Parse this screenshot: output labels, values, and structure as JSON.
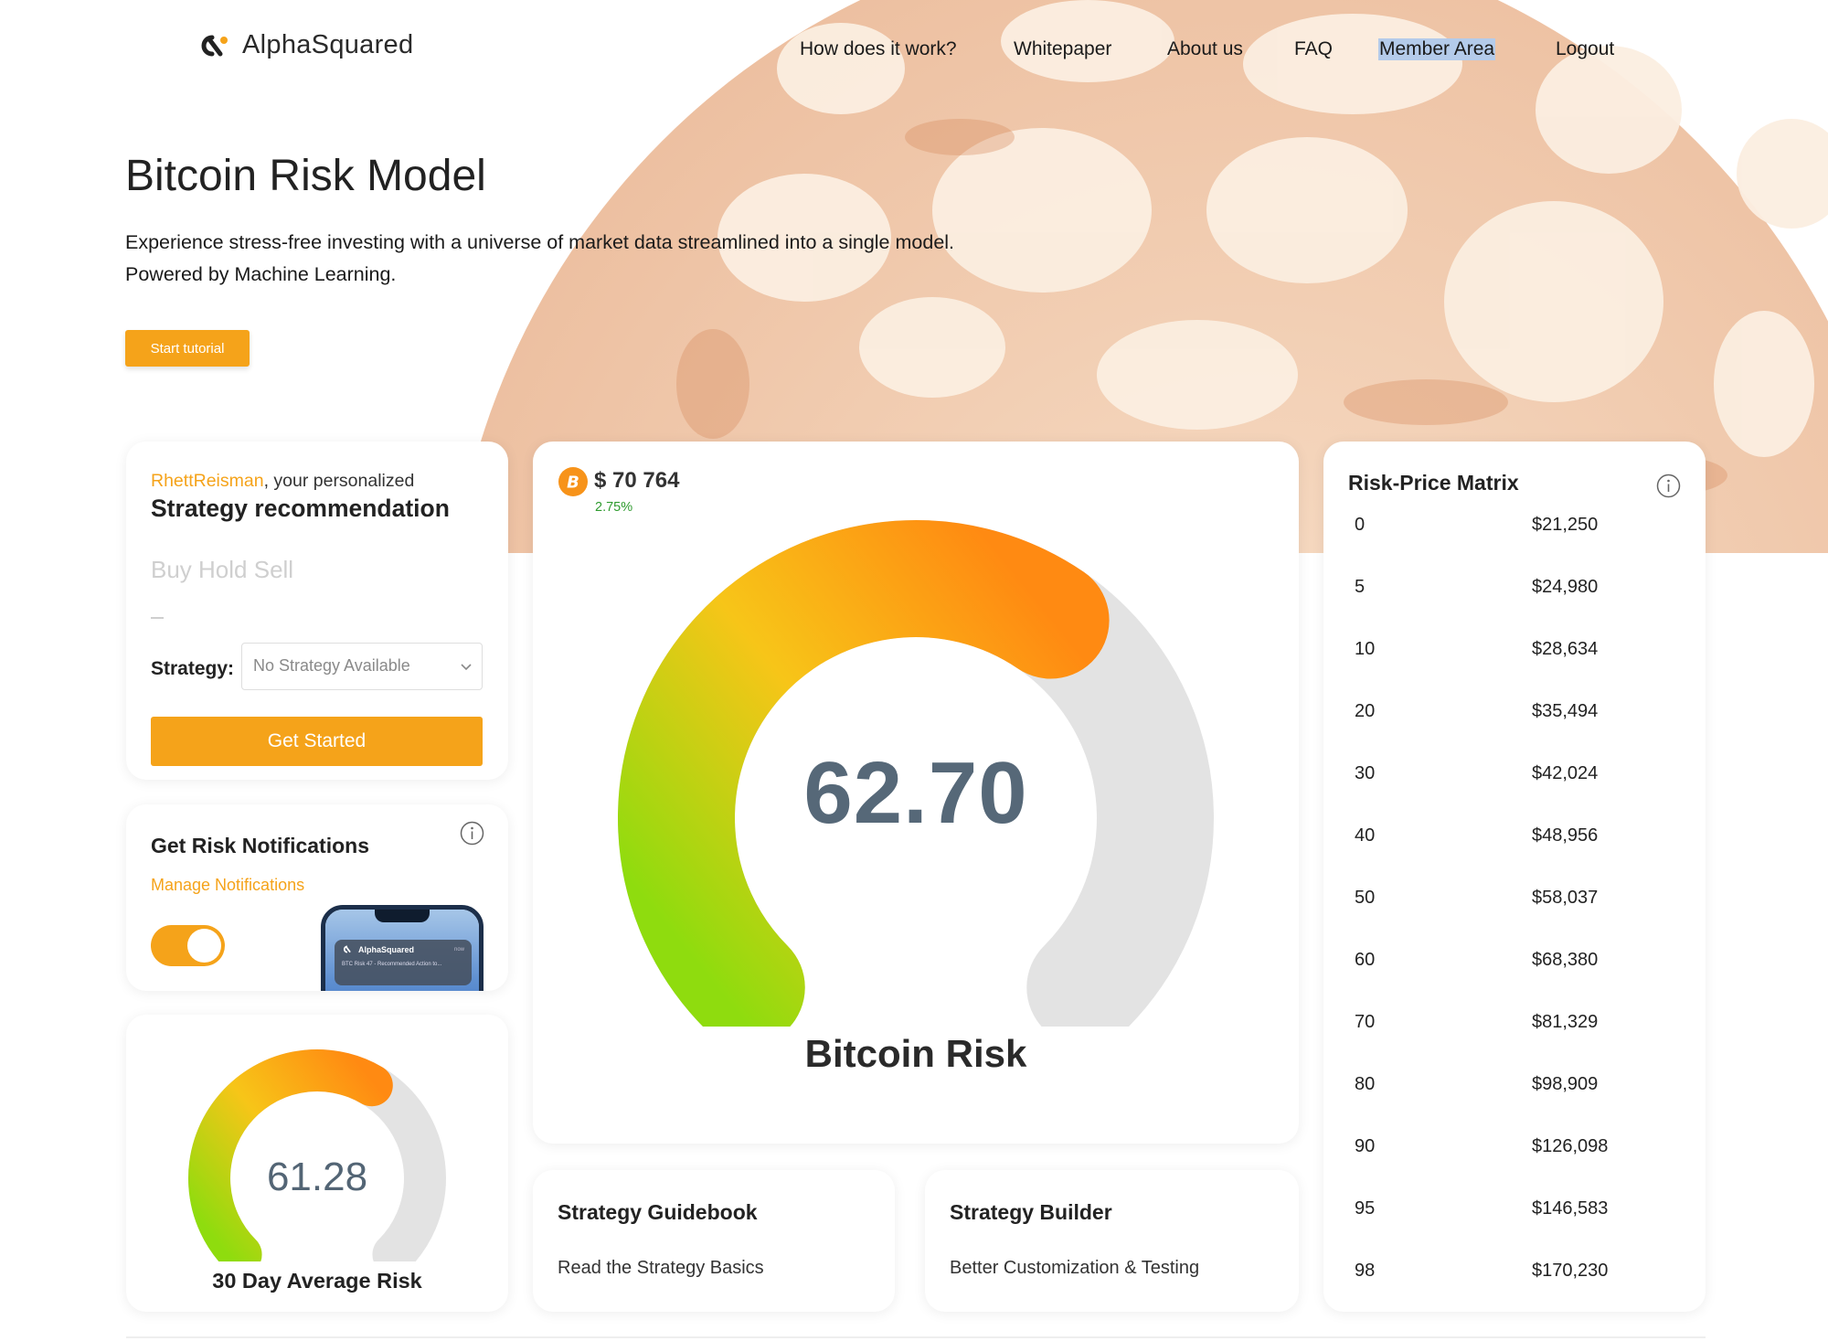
{
  "brand": {
    "name": "AlphaSquared",
    "accent": "#f5a31a"
  },
  "nav": {
    "items": [
      {
        "label": "How does it work?"
      },
      {
        "label": "Whitepaper"
      },
      {
        "label": "About us"
      },
      {
        "label": "FAQ"
      },
      {
        "label": "Member Area",
        "active": true
      },
      {
        "label": "Logout"
      }
    ]
  },
  "hero": {
    "title": "Bitcoin Risk Model",
    "subtitle_line1": "Experience stress-free investing with a universe of market data streamlined into a single model.",
    "subtitle_line2": "Powered by Machine Learning.",
    "tutorial_button": "Start tutorial"
  },
  "strategy_card": {
    "username": "RhettReisman",
    "intro_suffix": ", your personalized",
    "heading": "Strategy recommendation",
    "actions_placeholder": "Buy Hold Sell",
    "strategy_label": "Strategy:",
    "strategy_select_value": "No Strategy Available",
    "cta_button": "Get Started"
  },
  "notifications_card": {
    "title": "Get Risk Notifications",
    "link": "Manage Notifications",
    "toggle_on": true,
    "phone_preview": {
      "app_name": "AlphaSquared",
      "message": "BTC Risk 47 - Recommended Action to...",
      "time": "now"
    }
  },
  "average_card": {
    "value": "61.28",
    "risk": 61.28,
    "label": "30 Day Average Risk"
  },
  "main_gauge": {
    "price": "$ 70 764",
    "change": "2.75%",
    "value": "62.70",
    "risk": 62.7,
    "label": "Bitcoin Risk",
    "gradient_colors": [
      "#8fdc0e",
      "#f7c518",
      "#ff8a12"
    ],
    "track_color": "#e3e3e3"
  },
  "guidebook_card": {
    "title": "Strategy Guidebook",
    "subtitle": "Read the Strategy Basics"
  },
  "builder_card": {
    "title": "Strategy Builder",
    "subtitle": "Better Customization & Testing"
  },
  "matrix_card": {
    "title": "Risk-Price Matrix",
    "rows": [
      {
        "risk": "0",
        "price": "$21,250"
      },
      {
        "risk": "5",
        "price": "$24,980"
      },
      {
        "risk": "10",
        "price": "$28,634"
      },
      {
        "risk": "20",
        "price": "$35,494"
      },
      {
        "risk": "30",
        "price": "$42,024"
      },
      {
        "risk": "40",
        "price": "$48,956"
      },
      {
        "risk": "50",
        "price": "$58,037"
      },
      {
        "risk": "60",
        "price": "$68,380"
      },
      {
        "risk": "70",
        "price": "$81,329"
      },
      {
        "risk": "80",
        "price": "$98,909"
      },
      {
        "risk": "90",
        "price": "$126,098"
      },
      {
        "risk": "95",
        "price": "$146,583"
      },
      {
        "risk": "98",
        "price": "$170,230"
      }
    ]
  }
}
